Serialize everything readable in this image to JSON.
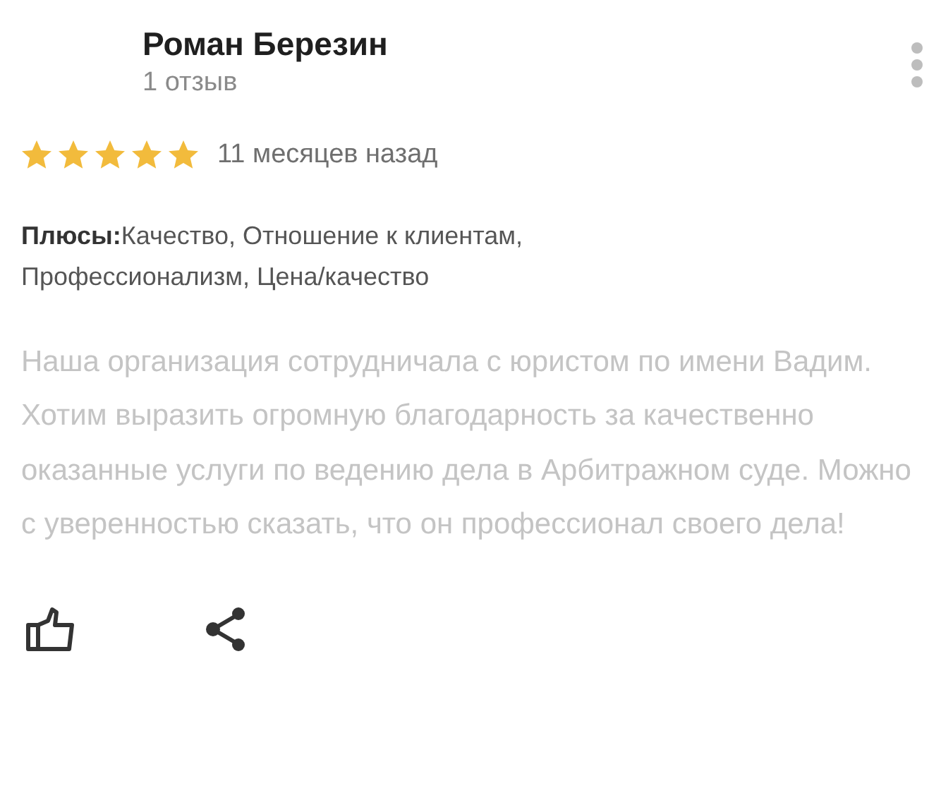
{
  "review": {
    "author": "Роман Березин",
    "review_count": "1 отзыв",
    "stars": 5,
    "date": "11 месяцев назад",
    "pros_label": "Плюсы:",
    "pros": "Качество, Отношение к клиентам, Профессионализм, Цена/качество",
    "text": "Наша организация сотрудничала с юристом по имени Вадим. Хотим выразить огромную благодарность за качественно оказанные услуги по ведению дела в Арбитражном суде. Можно с уверенностью сказать, что он профессионал своего дела!"
  }
}
